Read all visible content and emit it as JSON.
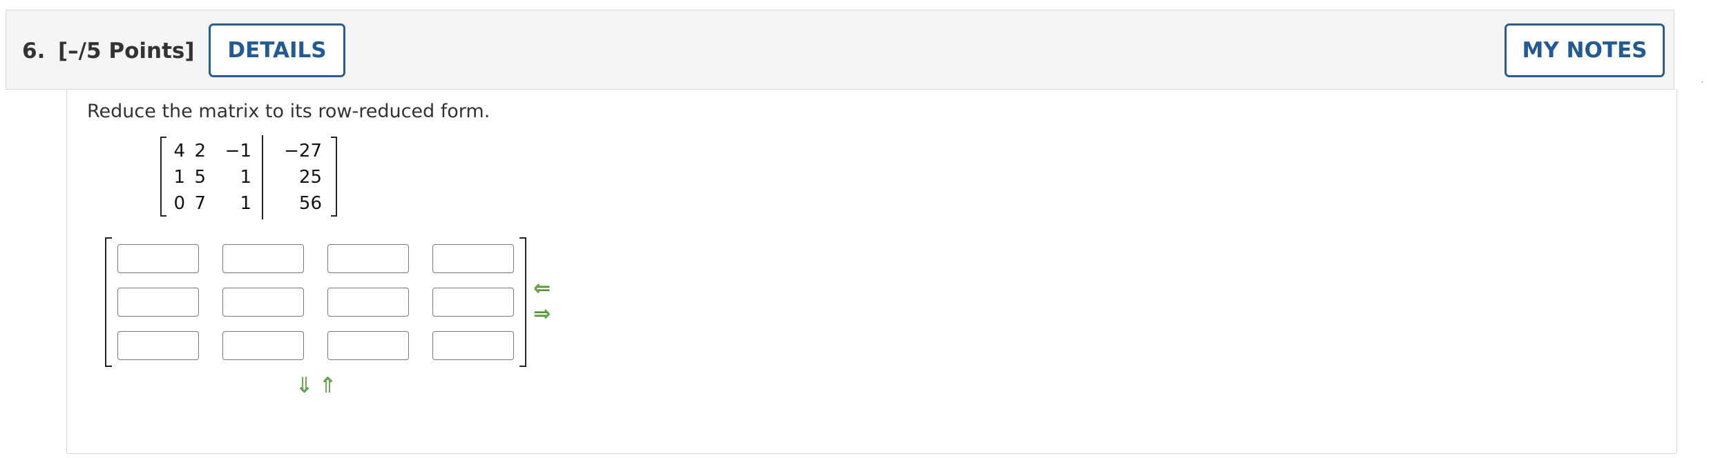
{
  "header": {
    "question_number": "6.",
    "points": "[–/5 Points]",
    "details_label": "DETAILS",
    "my_notes_label": "MY NOTES"
  },
  "question": {
    "prompt": "Reduce the matrix to its row-reduced form.",
    "given_matrix": {
      "rows": [
        [
          "4",
          "2",
          "−1",
          "−27"
        ],
        [
          "1",
          "5",
          "1",
          "25"
        ],
        [
          "0",
          "7",
          "1",
          "56"
        ]
      ]
    },
    "answer_matrix": {
      "rows": 3,
      "cols": 4,
      "values": [
        [
          "",
          "",
          "",
          ""
        ],
        [
          "",
          "",
          "",
          ""
        ],
        [
          "",
          "",
          "",
          ""
        ]
      ]
    },
    "controls": {
      "remove_column_icon": "arrow-left-icon",
      "add_column_icon": "arrow-right-icon",
      "add_row_icon": "arrow-down-icon",
      "remove_row_icon": "arrow-up-icon",
      "accent_color": "#6aa84f"
    }
  },
  "colors": {
    "button_border": "#2a5c8e",
    "button_text": "#245a92",
    "header_bg": "#f5f5f5"
  }
}
